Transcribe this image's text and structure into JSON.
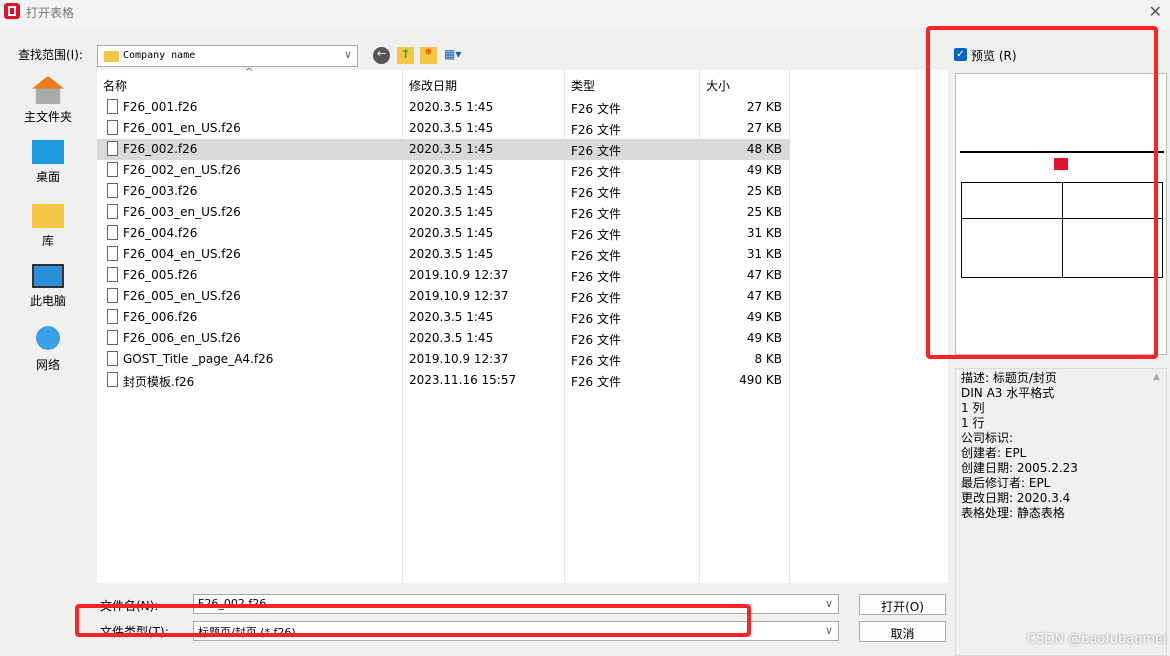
{
  "window": {
    "title": "打开表格",
    "close": "✕"
  },
  "lookin": {
    "label": "查找范围(I):",
    "value": "Company name"
  },
  "places": [
    {
      "label": "主文件夹",
      "icon": "home-icon"
    },
    {
      "label": "桌面",
      "icon": "desktop-icon"
    },
    {
      "label": "库",
      "icon": "library-icon"
    },
    {
      "label": "此电脑",
      "icon": "computer-icon"
    },
    {
      "label": "网络",
      "icon": "network-icon"
    }
  ],
  "columns": {
    "name": "名称",
    "date": "修改日期",
    "type": "类型",
    "size": "大小"
  },
  "files": [
    {
      "name": "F26_001.f26",
      "date": "2020.3.5 1:45",
      "type": "F26 文件",
      "size": "27 KB"
    },
    {
      "name": "F26_001_en_US.f26",
      "date": "2020.3.5 1:45",
      "type": "F26 文件",
      "size": "27 KB"
    },
    {
      "name": "F26_002.f26",
      "date": "2020.3.5 1:45",
      "type": "F26 文件",
      "size": "48 KB",
      "selected": true
    },
    {
      "name": "F26_002_en_US.f26",
      "date": "2020.3.5 1:45",
      "type": "F26 文件",
      "size": "49 KB"
    },
    {
      "name": "F26_003.f26",
      "date": "2020.3.5 1:45",
      "type": "F26 文件",
      "size": "25 KB"
    },
    {
      "name": "F26_003_en_US.f26",
      "date": "2020.3.5 1:45",
      "type": "F26 文件",
      "size": "25 KB"
    },
    {
      "name": "F26_004.f26",
      "date": "2020.3.5 1:45",
      "type": "F26 文件",
      "size": "31 KB"
    },
    {
      "name": "F26_004_en_US.f26",
      "date": "2020.3.5 1:45",
      "type": "F26 文件",
      "size": "31 KB"
    },
    {
      "name": "F26_005.f26",
      "date": "2019.10.9 12:37",
      "type": "F26 文件",
      "size": "47 KB"
    },
    {
      "name": "F26_005_en_US.f26",
      "date": "2019.10.9 12:37",
      "type": "F26 文件",
      "size": "47 KB"
    },
    {
      "name": "F26_006.f26",
      "date": "2020.3.5 1:45",
      "type": "F26 文件",
      "size": "49 KB"
    },
    {
      "name": "F26_006_en_US.f26",
      "date": "2020.3.5 1:45",
      "type": "F26 文件",
      "size": "49 KB"
    },
    {
      "name": "GOST_Title _page_A4.f26",
      "date": "2019.10.9 12:37",
      "type": "F26 文件",
      "size": "8 KB"
    },
    {
      "name": "封页模板.f26",
      "date": "2023.11.16 15:57",
      "type": "F26 文件",
      "size": "490 KB"
    }
  ],
  "filename": {
    "label": "文件名(N):",
    "value": "F26_002.f26"
  },
  "filetype": {
    "label": "文件类型(T):",
    "value": "标题页/封页 (*.f26)"
  },
  "buttons": {
    "open": "打开(O)",
    "cancel": "取消"
  },
  "preview": {
    "label": "预览 (R)",
    "checked": true
  },
  "description": [
    "描述: 标题页/封页",
    "DIN A3 水平格式",
    "1 列",
    "1 行",
    "公司标识:",
    "创建者: EPL",
    "创建日期: 2005.2.23",
    "最后修订者: EPL",
    "更改日期: 2020.3.4",
    "表格处理: 静态表格"
  ],
  "watermark": "CSDN @baofubaomei",
  "colors": {
    "annotation": "#ff2222",
    "selection": "#d9d9d9",
    "accent": "#0067c0"
  }
}
